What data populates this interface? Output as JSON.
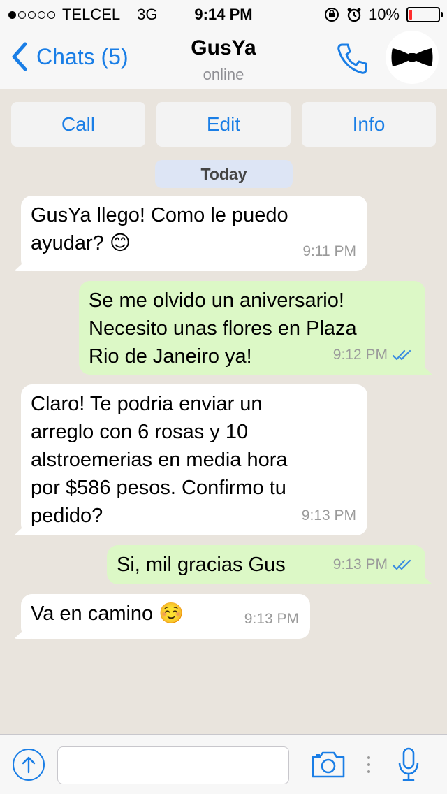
{
  "status": {
    "carrier": "TELCEL",
    "network": "3G",
    "time": "9:14 PM",
    "battery": "10%",
    "battery_level": 0.1,
    "signal_bars_filled": 1,
    "signal_bars_total": 5
  },
  "nav": {
    "back_label": "Chats (5)",
    "title": "GusYa",
    "subtitle": "online"
  },
  "actions": {
    "call": "Call",
    "edit": "Edit",
    "info": "Info"
  },
  "day_label": "Today",
  "messages": [
    {
      "direction": "incoming",
      "text": "GusYa llego! Como le puedo\nayudar? 😊",
      "time": "9:11 PM"
    },
    {
      "direction": "outgoing",
      "text": "Se me olvido un aniversario!\nNecesito unas flores en Plaza\nRio de Janeiro ya!",
      "time": "9:12 PM",
      "read": true
    },
    {
      "direction": "incoming",
      "text": "Claro! Te podria enviar un\narreglo con 6 rosas y 10\nalstroemerias en media hora\npor $586 pesos. Confirmo tu\npedido?",
      "time": "9:13 PM"
    },
    {
      "direction": "outgoing",
      "text": "Si, mil gracias Gus",
      "time": "9:13 PM",
      "read": true
    },
    {
      "direction": "incoming",
      "text": "Va en camino ☺️",
      "time": "9:13 PM"
    }
  ],
  "input": {
    "placeholder": ""
  },
  "colors": {
    "accent": "#1a7ee6",
    "outgoing_bubble": "#dcf8c6",
    "incoming_bubble": "#ffffff",
    "background": "#e9e4dd",
    "read_ticks": "#3b8de0"
  },
  "icons": {
    "back": "chevron-left-icon",
    "call": "phone-icon",
    "avatar": "bow-tie-icon",
    "upload": "share-up-icon",
    "camera": "camera-icon",
    "mic": "microphone-icon"
  }
}
